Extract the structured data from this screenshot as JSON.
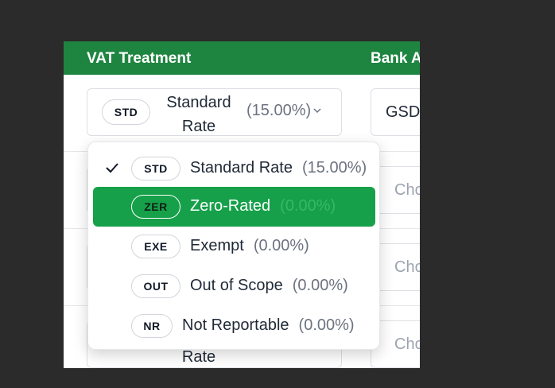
{
  "table": {
    "headers": {
      "vat": "VAT Treatment",
      "bank": "Bank A"
    }
  },
  "row1": {
    "vat": {
      "code": "STD",
      "name": "Standard Rate",
      "rate": "(15.00%)"
    },
    "bank": {
      "value": "GSD"
    }
  },
  "rows_behind": {
    "bank_placeholder": "Cho",
    "last_vat_name_fragment": "Rate"
  },
  "dropdown": {
    "options": [
      {
        "code": "STD",
        "name": "Standard Rate",
        "rate": "(15.00%)",
        "selected": true,
        "highlighted": false
      },
      {
        "code": "ZER",
        "name": "Zero-Rated",
        "rate": "(0.00%)",
        "selected": false,
        "highlighted": true
      },
      {
        "code": "EXE",
        "name": "Exempt",
        "rate": "(0.00%)",
        "selected": false,
        "highlighted": false
      },
      {
        "code": "OUT",
        "name": "Out of Scope",
        "rate": "(0.00%)",
        "selected": false,
        "highlighted": false
      },
      {
        "code": "NR",
        "name": "Not Reportable",
        "rate": "(0.00%)",
        "selected": false,
        "highlighted": false
      }
    ]
  },
  "colors": {
    "header_bg": "#1e8540",
    "highlight_bg": "#16a04a",
    "page_bg": "#2b2b2b"
  },
  "icons": {
    "checkmark": "check-icon",
    "chevron": "chevron-down-icon"
  }
}
